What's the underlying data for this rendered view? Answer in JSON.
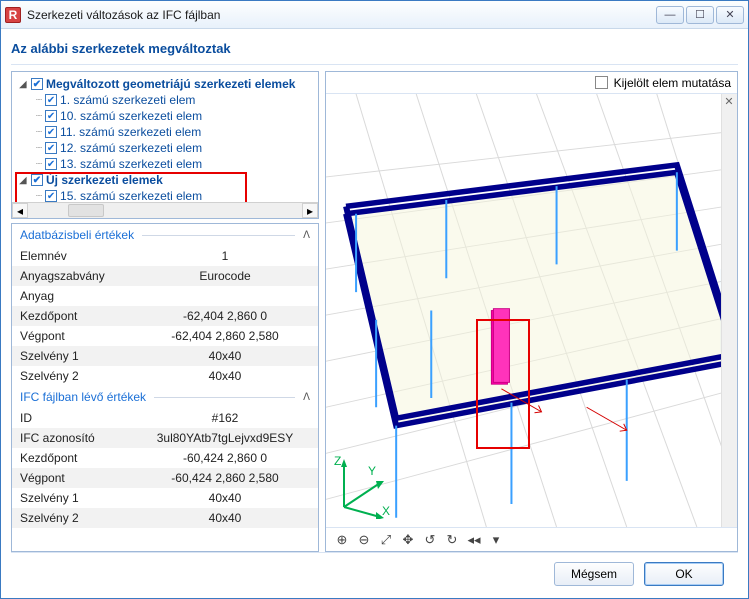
{
  "window": {
    "title": "Szerkezeti változások az IFC fájlban",
    "icon_letter": "R"
  },
  "subtitle": "Az alábbi szerkezetek megváltoztak",
  "tree": {
    "group1_label": "Megváltozott geometriájú szerkezeti elemek",
    "items1": [
      "1. számú szerkezeti elem",
      "10. számú szerkezeti elem",
      "11. számú szerkezeti elem",
      "12. számú szerkezeti elem",
      "13. számú szerkezeti elem"
    ],
    "group2_label": "Új szerkezeti elemek",
    "items2": [
      "15. számú szerkezeti elem"
    ]
  },
  "props": {
    "section1": "Adatbázisbeli értékek",
    "rows1": [
      {
        "k": "Elemnév",
        "v": "1"
      },
      {
        "k": "Anyagszabvány",
        "v": "Eurocode"
      },
      {
        "k": "Anyag",
        "v": ""
      },
      {
        "k": "Kezdőpont",
        "v": "-62,404 2,860 0"
      },
      {
        "k": "Végpont",
        "v": "-62,404 2,860 2,580"
      },
      {
        "k": "Szelvény 1",
        "v": "40x40"
      },
      {
        "k": "Szelvény 2",
        "v": "40x40"
      }
    ],
    "section2": "IFC fájlban lévő értékek",
    "rows2": [
      {
        "k": "ID",
        "v": "#162"
      },
      {
        "k": "IFC azonosító",
        "v": "3ul80YAtb7tgLejvxd9ESY"
      },
      {
        "k": "Kezdőpont",
        "v": "-60,424 2,860 0"
      },
      {
        "k": "Végpont",
        "v": "-60,424 2,860 2,580"
      },
      {
        "k": "Szelvény 1",
        "v": "40x40"
      },
      {
        "k": "Szelvény 2",
        "v": "40x40"
      }
    ]
  },
  "right": {
    "show_selected_label": "Kijelölt elem mutatása"
  },
  "axes": {
    "x": "X",
    "y": "Y",
    "z": "Z"
  },
  "footer": {
    "cancel": "Mégsem",
    "ok": "OK"
  }
}
